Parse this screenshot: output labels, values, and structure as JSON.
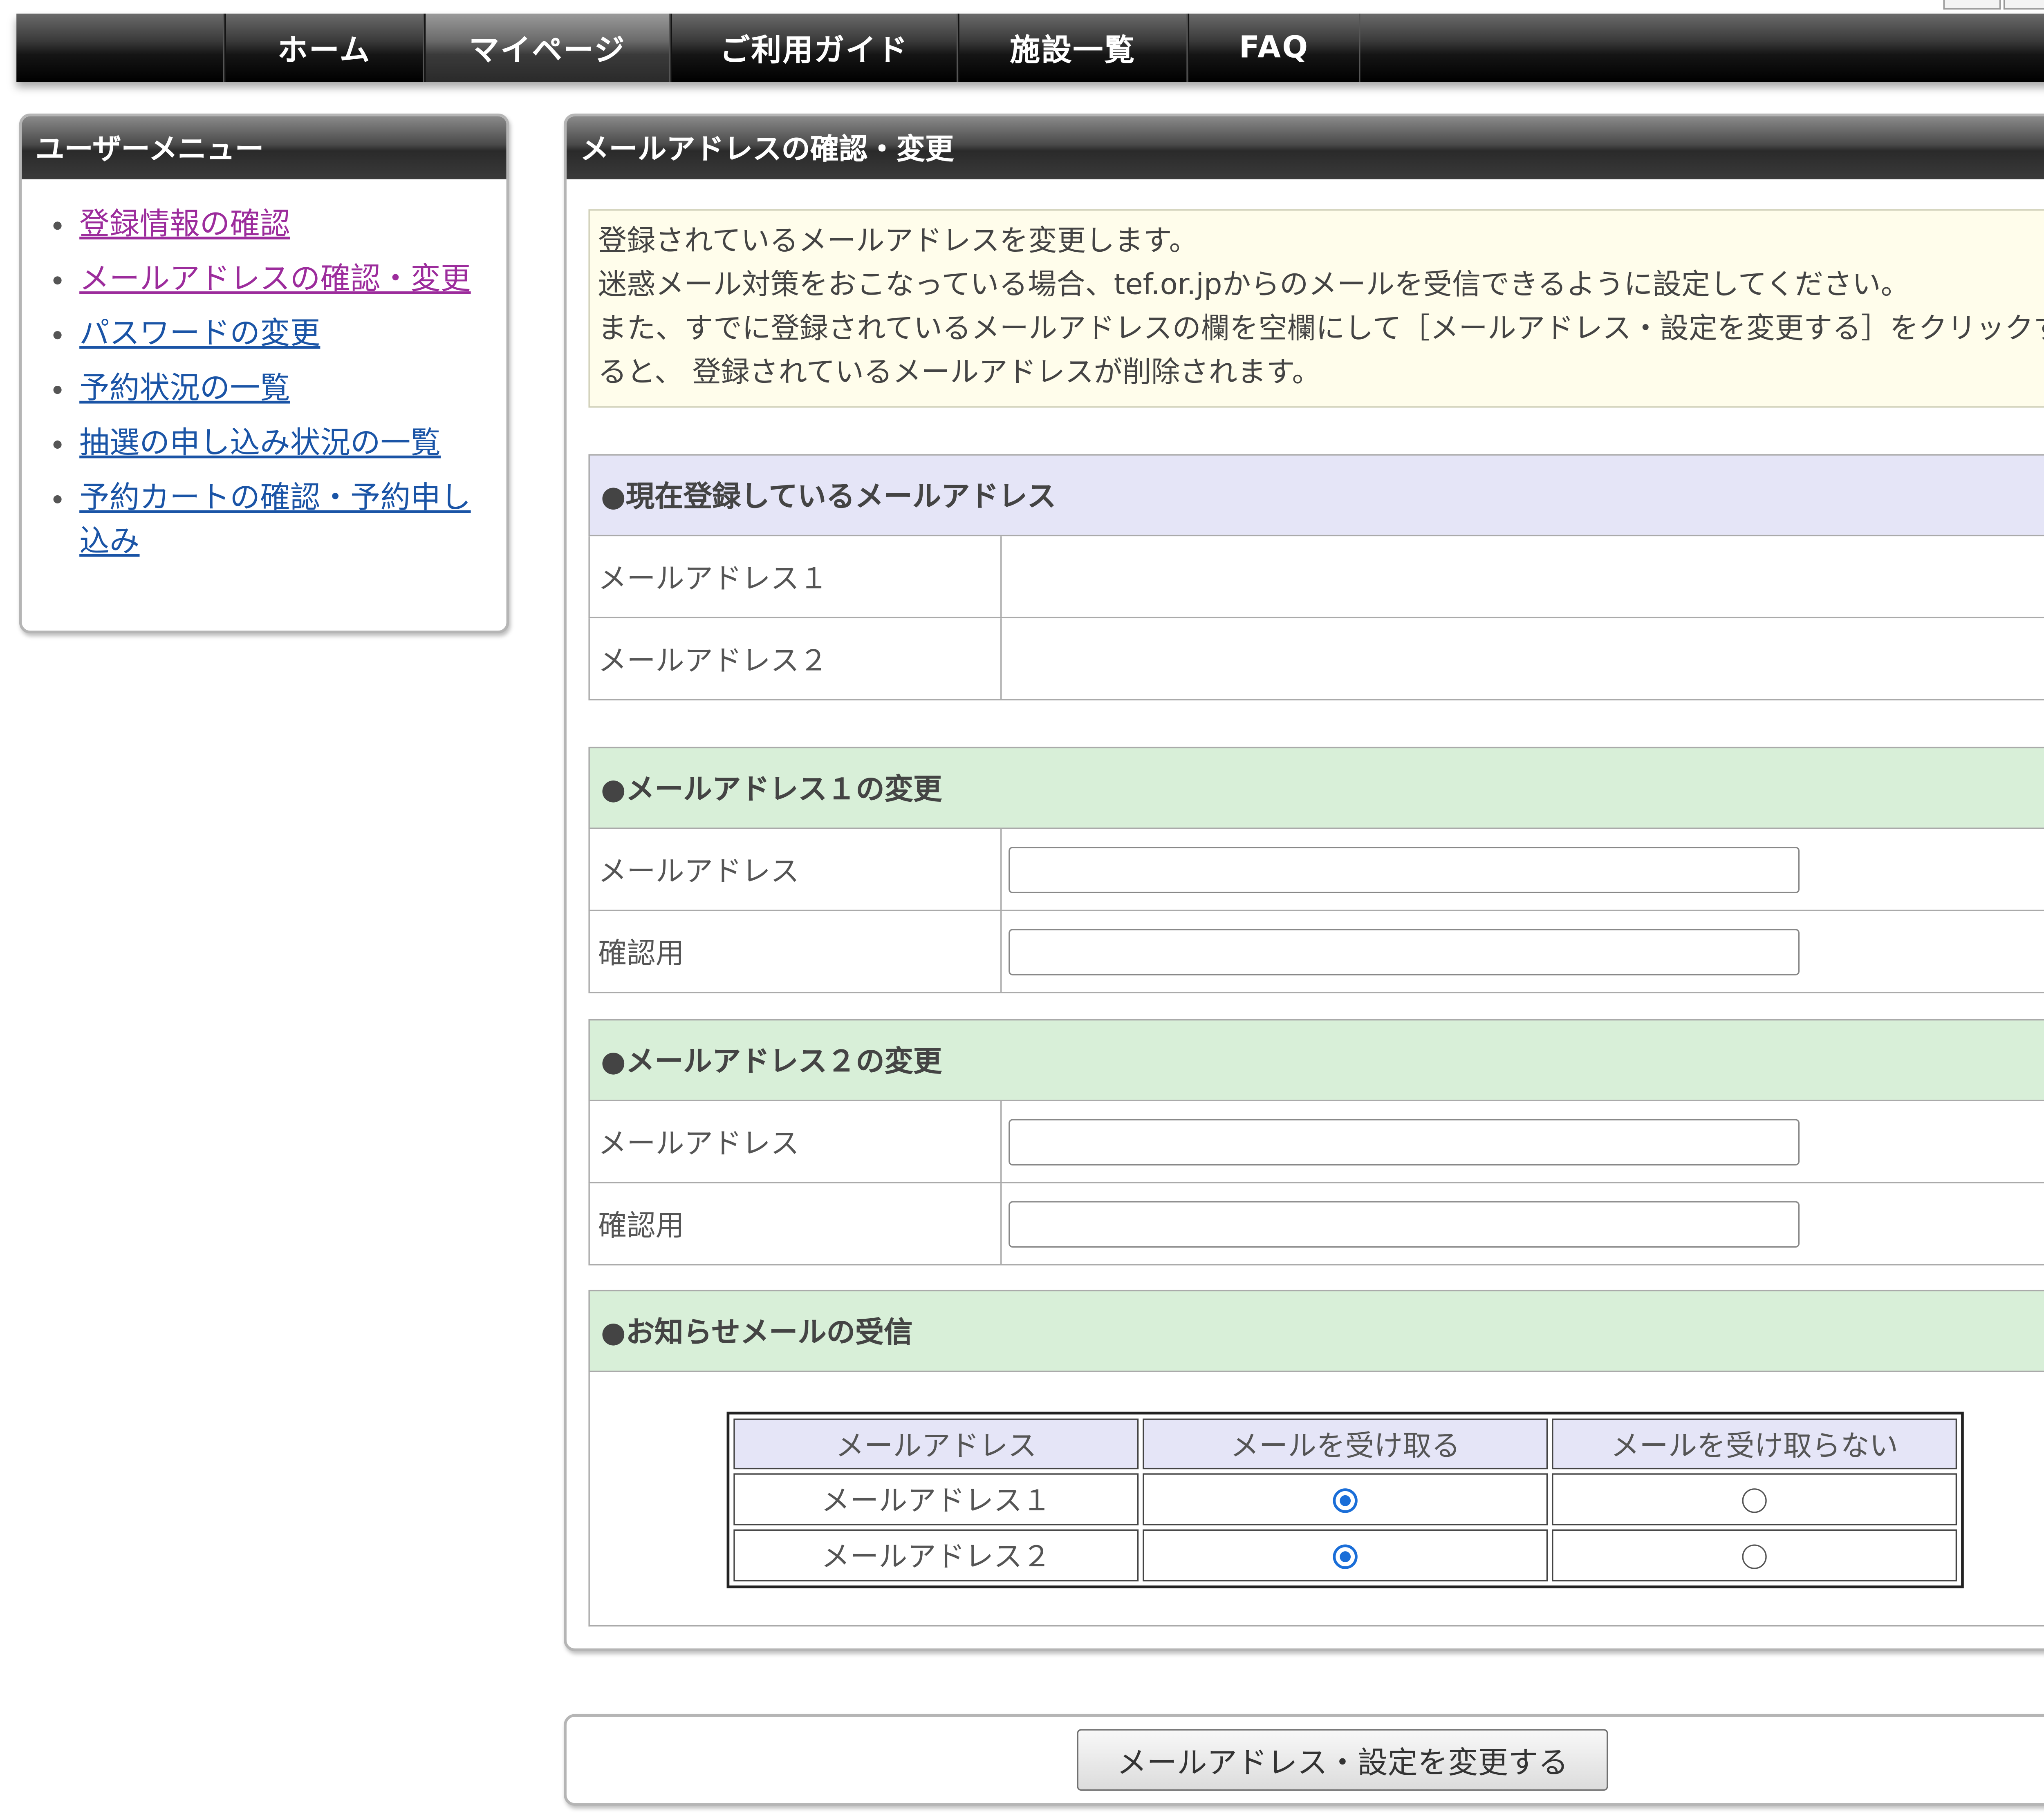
{
  "nav": {
    "items": [
      "ホーム",
      "マイページ",
      "ご利用ガイド",
      "施設一覧",
      "FAQ"
    ],
    "active": "マイページ"
  },
  "sidebar": {
    "title": "ユーザーメニュー",
    "items": [
      {
        "label": "登録情報の確認",
        "visited": true
      },
      {
        "label": "メールアドレスの確認・変更",
        "visited": true
      },
      {
        "label": "パスワードの変更",
        "visited": false
      },
      {
        "label": "予約状況の一覧",
        "visited": false
      },
      {
        "label": "抽選の申し込み状況の一覧",
        "visited": false
      },
      {
        "label": "予約カートの確認・予約申し込み",
        "visited": false
      }
    ]
  },
  "main": {
    "title": "メールアドレスの確認・変更",
    "help_icon": "?",
    "notice": [
      "登録されているメールアドレスを変更します。",
      "迷惑メール対策をおこなっている場合、tef.or.jpからのメールを受信できるように設定してください。",
      "また、すでに登録されているメールアドレスの欄を空欄にして［メールアドレス・設定を変更する］をクリックすると、 登録されているメールアドレスが削除されます。"
    ],
    "current": {
      "heading": "●現在登録しているメールアドレス",
      "rows": [
        {
          "label": "メールアドレス１",
          "value": ""
        },
        {
          "label": "メールアドレス２",
          "value": ""
        }
      ]
    },
    "change1": {
      "heading": "●メールアドレス１の変更",
      "email_label": "メールアドレス",
      "confirm_label": "確認用",
      "email_value": "",
      "confirm_value": ""
    },
    "change2": {
      "heading": "●メールアドレス２の変更",
      "email_label": "メールアドレス",
      "confirm_label": "確認用",
      "email_value": "",
      "confirm_value": ""
    },
    "notify": {
      "heading": "●お知らせメールの受信",
      "columns": [
        "メールアドレス",
        "メールを受け取る",
        "メールを受け取らない"
      ],
      "rows": [
        {
          "label": "メールアドレス１",
          "receive": true
        },
        {
          "label": "メールアドレス２",
          "receive": true
        }
      ]
    }
  },
  "submit": {
    "label": "メールアドレス・設定を変更する"
  },
  "colors": {
    "link": "#1a54a6",
    "visited_link": "#9c2c9c",
    "section_blue": "#e5e5f7",
    "section_green": "#d8efd8",
    "notice_bg": "#fffdeb",
    "radio_accent": "#1a6ed8"
  }
}
